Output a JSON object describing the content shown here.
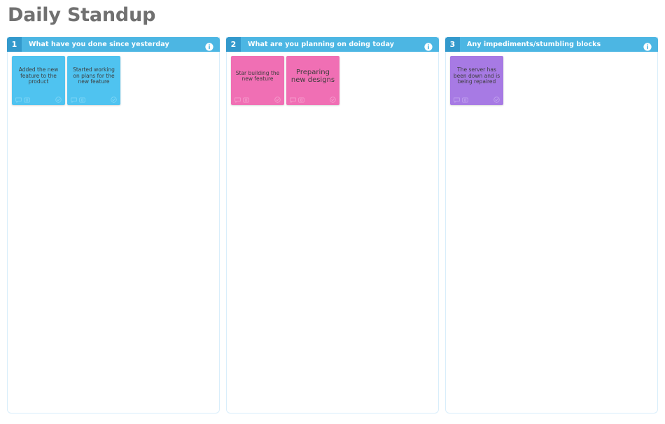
{
  "board": {
    "title": "Daily Standup"
  },
  "colors": {
    "header_bar": "#4cb6e3",
    "header_number": "#3399cc",
    "column_border": "#d9eefb",
    "card_blue": "#4fc3f0",
    "card_pink": "#f06fb4",
    "card_purple": "#a77ae4",
    "title_text": "#707070"
  },
  "icons": {
    "info": "info-icon",
    "comment": "comment-icon",
    "image": "image-icon",
    "check": "check-circle-icon"
  },
  "columns": [
    {
      "number": "1",
      "title": "What have you done since yesterday",
      "info_label": "i",
      "color": "blue",
      "cards": [
        {
          "text": "Added the new feature to the product",
          "size": "small"
        },
        {
          "text": "Started working on plans for the new feature",
          "size": "small"
        }
      ]
    },
    {
      "number": "2",
      "title": "What are you planning on doing today",
      "info_label": "i",
      "color": "pink",
      "cards": [
        {
          "text": "Star building the new feature",
          "size": "small"
        },
        {
          "text": "Preparing new designs",
          "size": "large"
        }
      ]
    },
    {
      "number": "3",
      "title": "Any impediments/stumbling blocks",
      "info_label": "i",
      "color": "purple",
      "cards": [
        {
          "text": "The server has been down and is being repaired",
          "size": "small"
        }
      ]
    }
  ]
}
